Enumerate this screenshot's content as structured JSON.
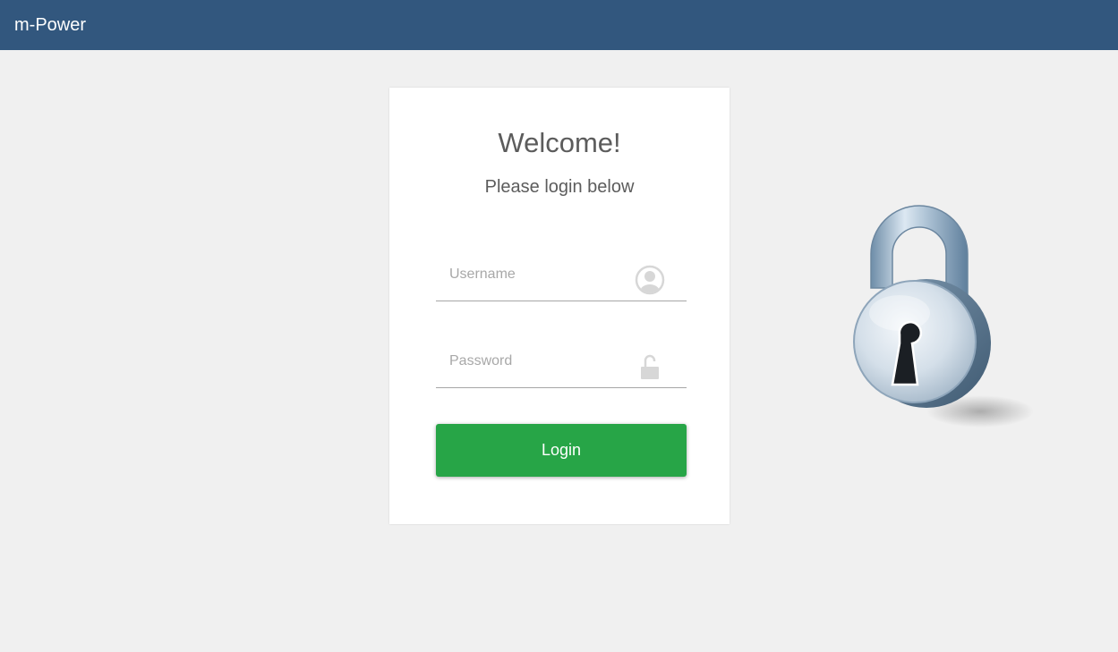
{
  "header": {
    "app_title": "m-Power",
    "background_color": "#32577e"
  },
  "login_card": {
    "welcome": "Welcome!",
    "subtitle": "Please login below",
    "username": {
      "placeholder": "Username",
      "value": "",
      "icon": "user-icon"
    },
    "password": {
      "placeholder": "Password",
      "value": "",
      "icon": "unlock-icon"
    },
    "login_label": "Login",
    "button_color": "#27a547"
  },
  "decoration": {
    "image": "padlock-icon"
  }
}
